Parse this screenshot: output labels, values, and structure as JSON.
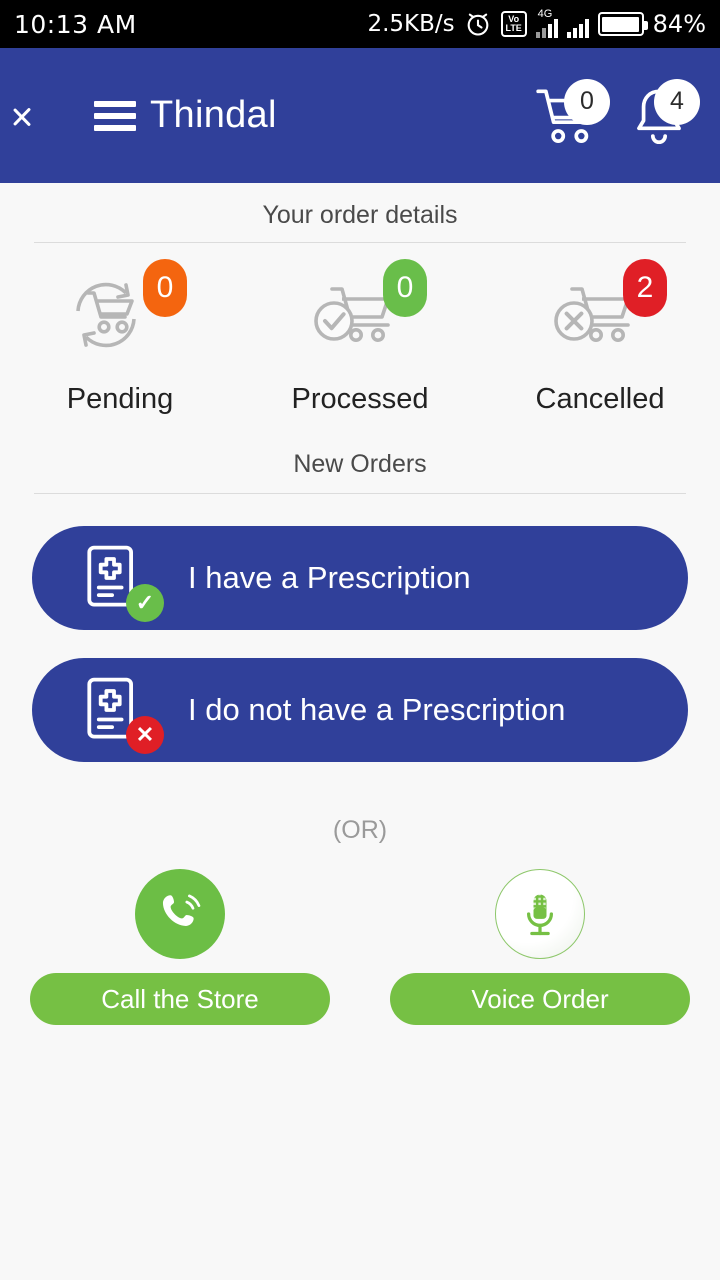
{
  "statusbar": {
    "time": "10:13 AM",
    "network_speed": "2.5KB/s",
    "alarm_icon": "alarm-clock-icon",
    "volte_top": "Vo",
    "volte_bottom": "LTE",
    "network_type": "4G",
    "battery_percent": "84%"
  },
  "header": {
    "back_icon": "back-chevron-icon",
    "menu_icon": "hamburger-menu-icon",
    "title": "Thindal",
    "cart_icon": "shopping-cart-icon",
    "cart_count": "0",
    "bell_icon": "notification-bell-icon",
    "bell_count": "4"
  },
  "order_details": {
    "section_title": "Your order details",
    "stats": [
      {
        "label": "Pending",
        "count": "0",
        "badge_color": "#f4650f",
        "icon": "cart-refresh-icon"
      },
      {
        "label": "Processed",
        "count": "0",
        "badge_color": "#69be4a",
        "icon": "cart-check-icon"
      },
      {
        "label": "Cancelled",
        "count": "2",
        "badge_color": "#e01f26",
        "icon": "cart-cancel-icon"
      }
    ]
  },
  "new_orders": {
    "section_title": "New Orders",
    "buttons": [
      {
        "label": "I have a Prescription",
        "icon": "prescription-check-icon",
        "badge_color": "#69be4a",
        "badge_glyph": "✓"
      },
      {
        "label": "I do not have a Prescription",
        "icon": "prescription-cancel-icon",
        "badge_color": "#e01f26",
        "badge_glyph": "✕"
      }
    ]
  },
  "separator": {
    "text": "(OR)"
  },
  "actions": [
    {
      "label": "Call the Store",
      "icon": "phone-call-icon"
    },
    {
      "label": "Voice Order",
      "icon": "microphone-icon"
    }
  ],
  "colors": {
    "primary_blue": "#30409a",
    "accent_green": "#76c044",
    "background": "#f8f8f8"
  }
}
